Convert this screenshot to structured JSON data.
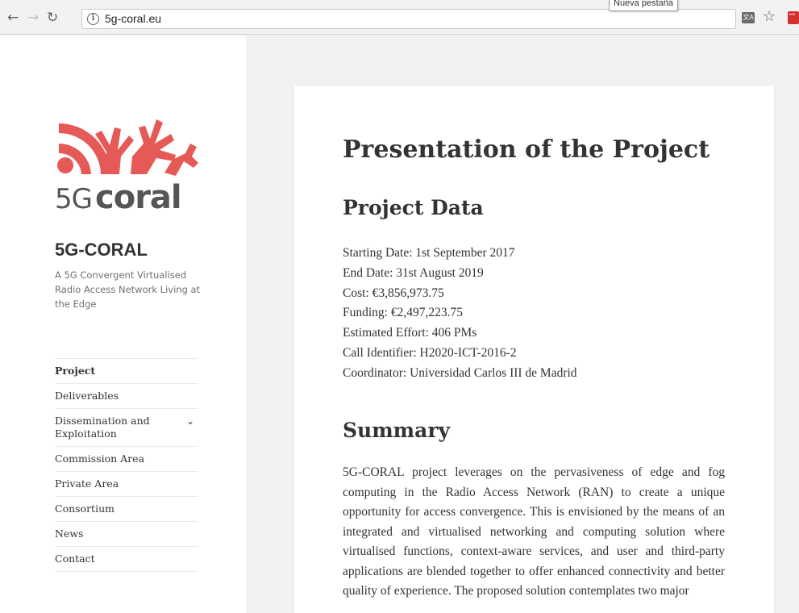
{
  "browser": {
    "url": "5g-coral.eu",
    "tooltip": "Nueva pestaña",
    "icons": [
      "back-arrow-icon",
      "forward-arrow-icon",
      "reload-icon",
      "info-icon",
      "translate-icon",
      "star-icon",
      "extension-icon"
    ]
  },
  "sidebar": {
    "logo_text": "5Gcoral",
    "logo_color": "#e55a56",
    "site_title": "5G-CORAL",
    "site_description": "A 5G Convergent Virtualised Radio Access Network Living at the Edge",
    "menu": [
      {
        "label": "Project",
        "active": true
      },
      {
        "label": "Deliverables"
      },
      {
        "label": "Dissemination and Exploitation",
        "has_submenu": true
      },
      {
        "label": "Commission Area"
      },
      {
        "label": "Private Area"
      },
      {
        "label": "Consortium"
      },
      {
        "label": "News"
      },
      {
        "label": "Contact"
      }
    ]
  },
  "main": {
    "title": "Presentation of the Project",
    "project_data_heading": "Project Data",
    "project_data": [
      "Starting Date: 1st September 2017",
      "End Date: 31st August 2019",
      "Cost: €3,856,973.75",
      "Funding: €2,497,223.75",
      "Estimated Effort: 406 PMs",
      "Call Identifier: H2020-ICT-2016-2",
      "Coordinator: Universidad Carlos III de Madrid"
    ],
    "summary_heading": "Summary",
    "summary_text": "5G-CORAL project leverages on the pervasiveness of edge and fog computing in the Radio Access Network (RAN) to create a unique opportunity for access convergence. This is envisioned by the means of an integrated and virtualised networking and computing solution where virtualised functions, context-aware services, and user and third-party applications are blended together to offer enhanced connectivity and better quality of experience. The proposed solution contemplates two major"
  }
}
